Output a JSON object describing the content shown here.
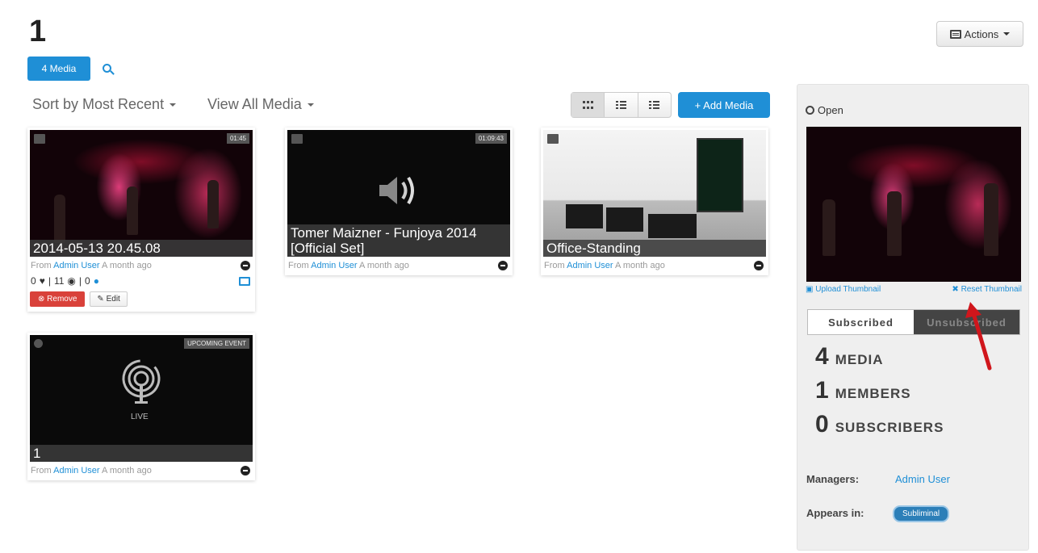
{
  "header": {
    "title": "1",
    "actions_label": "Actions",
    "media_count_label": "4 Media"
  },
  "toolbar": {
    "sort_label": "Sort by Most Recent",
    "view_label": "View All Media",
    "add_media_label": "+ Add Media"
  },
  "cards": [
    {
      "caption": "2014-05-13 20.45.08",
      "duration": "01:45",
      "from_prefix": "From",
      "author": "Admin User",
      "time": "A month ago",
      "likes": "0",
      "views": "11",
      "comments": "0",
      "remove_label": "Remove",
      "edit_label": "Edit"
    },
    {
      "caption": "Tomer Maizner - Funjoya 2014 [Official Set]",
      "duration": "01:09:43",
      "from_prefix": "From",
      "author": "Admin User",
      "time": "A month ago"
    },
    {
      "caption": "Office-Standing",
      "from_prefix": "From",
      "author": "Admin User",
      "time": "A month ago"
    },
    {
      "caption": "1",
      "badge": "UPCOMING EVENT",
      "live_label": "LIVE",
      "from_prefix": "From",
      "author": "Admin User",
      "time": "A month ago"
    }
  ],
  "sidebar": {
    "status": "Open",
    "upload_thumbnail": "Upload Thumbnail",
    "reset_thumbnail": "Reset Thumbnail",
    "subscribed": "Subscribed",
    "unsubscribed": "Unsubscribed",
    "stats": [
      {
        "num": "4",
        "label": "MEDIA"
      },
      {
        "num": "1",
        "label": "MEMBERS"
      },
      {
        "num": "0",
        "label": "SUBSCRIBERS"
      }
    ],
    "managers_label": "Managers:",
    "managers_value": "Admin User",
    "appears_label": "Appears in:",
    "appears_value": "Subliminal"
  },
  "colors": {
    "accent": "#1f8fd6",
    "danger": "#d9413a",
    "annotation_arrow": "#d0161c"
  }
}
